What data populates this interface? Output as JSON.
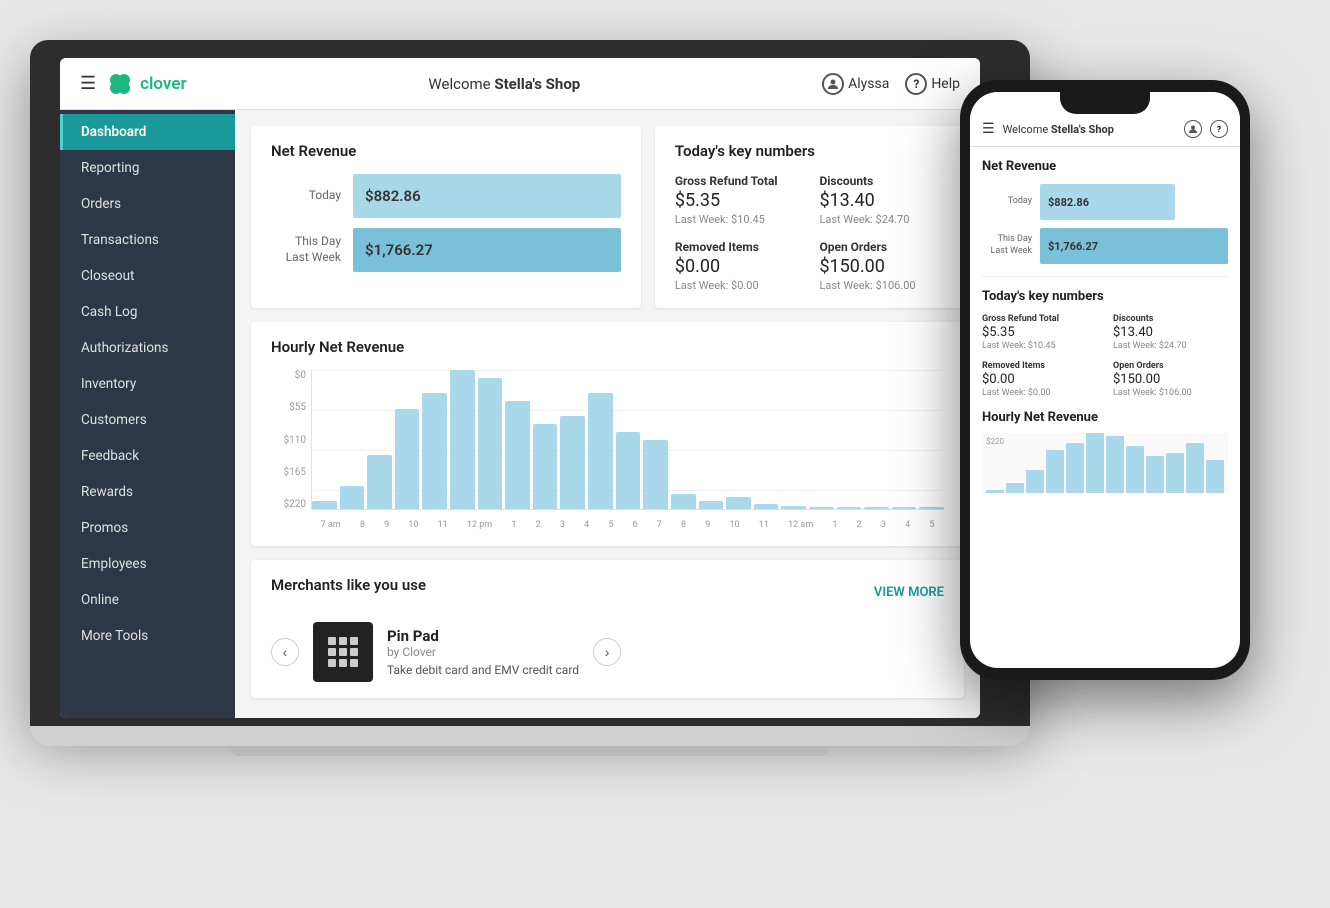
{
  "header": {
    "welcome_prefix": "Welcome ",
    "shop_name": "Stella's Shop",
    "user_label": "Alyssa",
    "help_label": "Help",
    "hamburger_symbol": "☰"
  },
  "sidebar": {
    "items": [
      {
        "id": "dashboard",
        "label": "Dashboard",
        "active": true
      },
      {
        "id": "reporting",
        "label": "Reporting",
        "active": false
      },
      {
        "id": "orders",
        "label": "Orders",
        "active": false
      },
      {
        "id": "transactions",
        "label": "Transactions",
        "active": false
      },
      {
        "id": "closeout",
        "label": "Closeout",
        "active": false
      },
      {
        "id": "cash-log",
        "label": "Cash Log",
        "active": false
      },
      {
        "id": "authorizations",
        "label": "Authorizations",
        "active": false
      },
      {
        "id": "inventory",
        "label": "Inventory",
        "active": false
      },
      {
        "id": "customers",
        "label": "Customers",
        "active": false
      },
      {
        "id": "feedback",
        "label": "Feedback",
        "active": false
      },
      {
        "id": "rewards",
        "label": "Rewards",
        "active": false
      },
      {
        "id": "promos",
        "label": "Promos",
        "active": false
      },
      {
        "id": "employees",
        "label": "Employees",
        "active": false
      },
      {
        "id": "online",
        "label": "Online",
        "active": false
      },
      {
        "id": "more-tools",
        "label": "More Tools",
        "active": false
      }
    ]
  },
  "net_revenue": {
    "title": "Net Revenue",
    "today_label": "Today",
    "today_value": "$882.86",
    "lastweek_label": "This Day\nLast Week",
    "lastweek_value": "$1,766.27"
  },
  "key_numbers": {
    "title": "Today's key numbers",
    "items": [
      {
        "label": "Gross Refund Total",
        "value": "$5.35",
        "sub": "Last Week: $10.45"
      },
      {
        "label": "Discounts",
        "value": "$13.40",
        "sub": "Last Week: $24.70"
      },
      {
        "label": "Removed Items",
        "value": "$0.00",
        "sub": "Last Week: $0.00"
      },
      {
        "label": "Open Orders",
        "value": "$150.00",
        "sub": "Last Week: $106.00"
      }
    ]
  },
  "hourly_chart": {
    "title": "Hourly Net Revenue",
    "y_labels": [
      "$220",
      "$165",
      "$110",
      "$55",
      "$0"
    ],
    "x_labels": [
      "7 am",
      "8",
      "9",
      "10",
      "11",
      "12 pm",
      "1",
      "2",
      "3",
      "4",
      "5",
      "6",
      "7",
      "8",
      "9",
      "10",
      "11",
      "12 am",
      "1",
      "2",
      "3",
      "4",
      "5"
    ],
    "bars": [
      5,
      15,
      35,
      65,
      75,
      90,
      85,
      70,
      55,
      60,
      75,
      50,
      45,
      10,
      5,
      8,
      3,
      2,
      1,
      1,
      0,
      0,
      0
    ]
  },
  "merchants": {
    "title": "Merchants like you use",
    "view_more": "VIEW MORE",
    "prev_symbol": "‹",
    "next_symbol": "›",
    "featured": {
      "name": "Pin Pad",
      "by": "by Clover",
      "description": "Take debit card and EMV credit card"
    }
  },
  "phone": {
    "welcome_prefix": "Welcome ",
    "shop_name": "Stella's Shop",
    "net_revenue_title": "Net Revenue",
    "today_label": "Today",
    "today_value": "$882.86",
    "lastweek_label": "This Day\nLast Week",
    "lastweek_value": "$1,766.27",
    "key_numbers_title": "Today's key numbers",
    "key_numbers": [
      {
        "label": "Gross Refund Total",
        "value": "$5.35",
        "sub": "Last Week: $10.45"
      },
      {
        "label": "Discounts",
        "value": "$13.40",
        "sub": "Last Week: $24.70"
      },
      {
        "label": "Removed Items",
        "value": "$0.00",
        "sub": "Last Week: $0.00"
      },
      {
        "label": "Open Orders",
        "value": "$150.00",
        "sub": "Last Week: $106.00"
      }
    ],
    "hourly_title": "Hourly Net Revenue",
    "chart_top_label": "$220",
    "mini_bars": [
      5,
      15,
      35,
      65,
      75,
      90,
      85,
      70,
      55,
      60,
      75,
      50
    ]
  }
}
